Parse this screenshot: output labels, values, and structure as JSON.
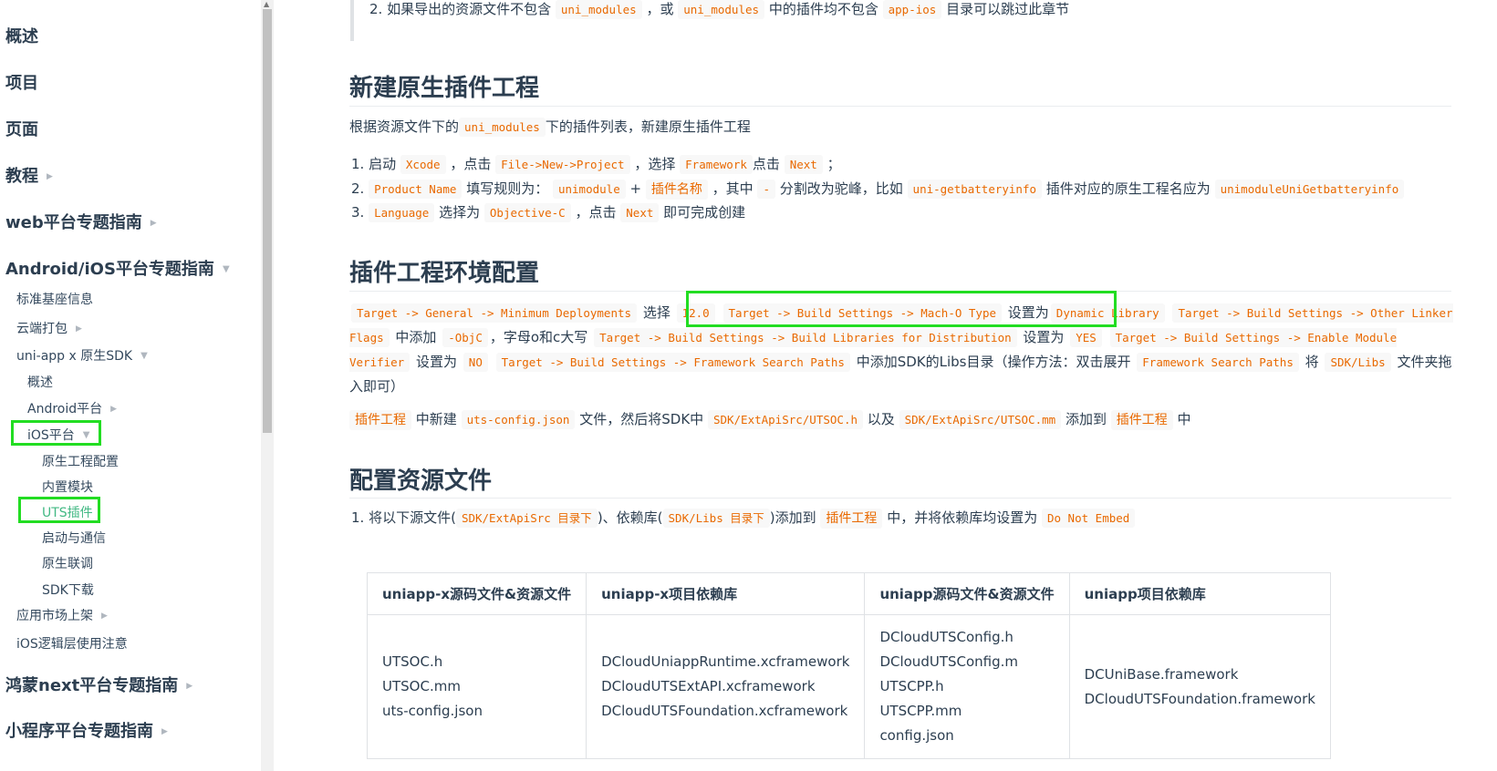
{
  "sidebar": {
    "top_items": [
      {
        "label": "概述"
      },
      {
        "label": "项目"
      },
      {
        "label": "页面"
      },
      {
        "label": "教程"
      },
      {
        "label": "web平台专题指南"
      },
      {
        "label": "Android/iOS平台专题指南"
      }
    ],
    "sub_items": [
      {
        "label": "标准基座信息"
      },
      {
        "label": "云端打包"
      },
      {
        "label": "uni-app x 原生SDK"
      },
      {
        "label": "概述"
      },
      {
        "label": "Android平台"
      },
      {
        "label": "iOS平台"
      },
      {
        "label": "原生工程配置"
      },
      {
        "label": "内置模块"
      },
      {
        "label": "UTS插件"
      },
      {
        "label": "启动与通信"
      },
      {
        "label": "原生联调"
      },
      {
        "label": "SDK下载"
      },
      {
        "label": "应用市场上架"
      },
      {
        "label": "iOS逻辑层使用注意"
      }
    ],
    "bottom_items": [
      {
        "label": "鸿蒙next平台专题指南"
      },
      {
        "label": "小程序平台专题指南"
      }
    ]
  },
  "content": {
    "quote": {
      "t1": "2. 如果导出的资源文件不包含",
      "c1": "uni_modules",
      "t2": "，或",
      "c2": "uni_modules",
      "t3": "中的插件均不包含",
      "c3": "app-ios",
      "t4": "目录可以跳过此章节"
    },
    "section1": {
      "title": "新建原生插件工程",
      "intro": {
        "t1": "根据资源文件下的",
        "c1": "uni_modules",
        "t2": "下的插件列表，新建原生插件工程"
      },
      "step1": {
        "n": "1.",
        "t1": "启动",
        "c1": "Xcode",
        "t2": "，点击",
        "c2": "File->New->Project",
        "t3": "，选择",
        "c3": "Framework",
        "t4": "点击",
        "c4": "Next",
        "t5": "；"
      },
      "step2": {
        "n": "2.",
        "c1": "Product Name",
        "t1": "填写规则为：",
        "c2": "unimodule",
        "t2": "+",
        "c3": "插件名称",
        "t3": "，其中",
        "c4": "-",
        "t4": "分割改为驼峰，比如",
        "c5": "uni-getbatteryinfo",
        "t5": "插件对应的原生工程名应为",
        "c6": "unimoduleUniGetbatteryinfo"
      },
      "step3": {
        "n": "3.",
        "c1": "Language",
        "t1": "选择为",
        "c2": "Objective-C",
        "t2": "，点击",
        "c3": "Next",
        "t3": "即可完成创建"
      }
    },
    "section2": {
      "title": "插件工程环境配置",
      "para": {
        "c1": "Target -> General -> Minimum Deployments",
        "t1": "选择",
        "c2": "12.0",
        "c3": "Target -> Build Settings -> Mach-O Type",
        "t2": "设置为",
        "c4": "Dynamic Library",
        "c5": "Target -> Build Settings -> Other Linker Flags",
        "t3": "中添加",
        "c6": "-ObjC",
        "t4": "，字母o和c大写",
        "c7": "Target -> Build Settings -> Build Libraries for Distribution",
        "t5": "设置为",
        "c8": "YES",
        "c9": "Target -> Build Settings -> Enable Module Verifier",
        "t6": "设置为",
        "c10": "NO",
        "c11": "Target -> Build Settings -> Framework Search Paths",
        "t7": "中添加SDK的Libs目录（操作方法：双击展开",
        "c12": "Framework Search Paths",
        "t8": "将",
        "c13": "SDK/Libs",
        "t9": "文件夹拖入即可）"
      },
      "para2": {
        "c1": "插件工程",
        "t1": "中新建",
        "c2": "uts-config.json",
        "t2": "文件，然后将SDK中",
        "c3": "SDK/ExtApiSrc/UTSOC.h",
        "t3": "以及",
        "c4": "SDK/ExtApiSrc/UTSOC.mm",
        "t4": "添加到",
        "c5": "插件工程",
        "t5": "中"
      }
    },
    "section3": {
      "title": "配置资源文件",
      "step1": {
        "n": "1.",
        "t1": "将以下源文件(",
        "c1": "SDK/ExtApiSrc 目录下",
        "t2": ")、依赖库(",
        "c2": "SDK/Libs 目录下",
        "t3": ")添加到",
        "c3": "插件工程",
        "t4": "中，并将依赖库均设置为",
        "c4": "Do Not Embed"
      },
      "table": {
        "headers": [
          "uniapp-x源码文件&资源文件",
          "uniapp-x项目依赖库",
          "uniapp源码文件&资源文件",
          "uniapp项目依赖库"
        ],
        "rows": [
          [
            [
              "UTSOC.h",
              "UTSOC.mm",
              "uts-config.json"
            ],
            [
              "DCloudUniappRuntime.xcframework",
              "DCloudUTSExtAPI.xcframework",
              "DCloudUTSFoundation.xcframework"
            ],
            [
              "DCloudUTSConfig.h",
              "DCloudUTSConfig.m",
              "UTSCPP.h",
              "UTSCPP.mm",
              "config.json"
            ],
            [
              "DCUniBase.framework",
              "DCloudUTSFoundation.framework"
            ]
          ]
        ]
      }
    }
  }
}
